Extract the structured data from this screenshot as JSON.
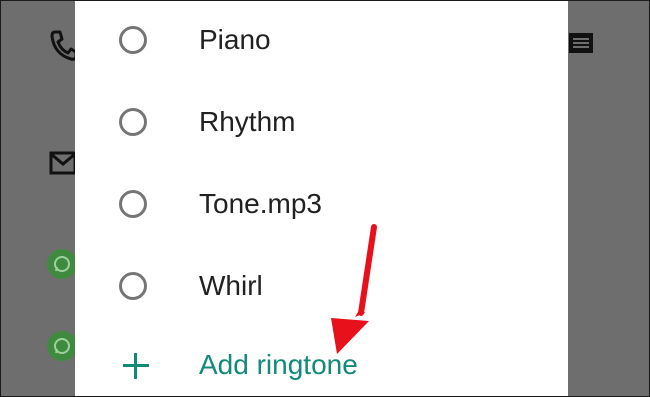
{
  "ringtone_options": [
    {
      "label": "Piano",
      "selected": false
    },
    {
      "label": "Rhythm",
      "selected": false
    },
    {
      "label": "Tone.mp3",
      "selected": false
    },
    {
      "label": "Whirl",
      "selected": false
    }
  ],
  "add_ringtone": {
    "label": "Add ringtone",
    "icon": "plus-icon"
  },
  "background_icons": [
    "phone-icon",
    "mail-icon",
    "whatsapp-icon",
    "whatsapp-icon",
    "message-icon"
  ],
  "colors": {
    "accent": "#128a7a",
    "overlay": "#6e6e6e",
    "annotation_arrow": "#e8101a",
    "whatsapp": "#3f8a3f"
  }
}
